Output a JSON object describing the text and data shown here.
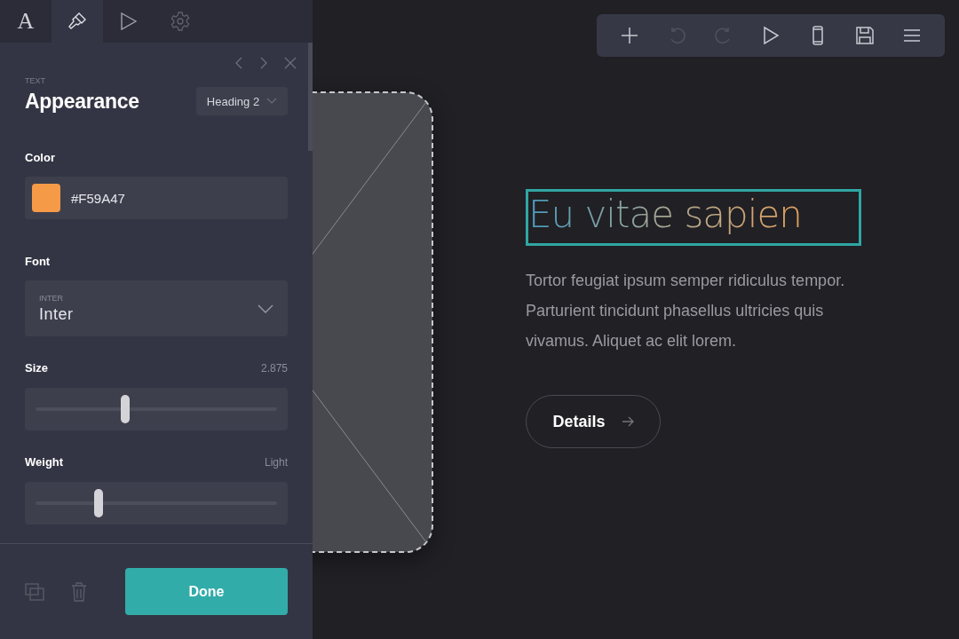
{
  "panel": {
    "tabs": [
      {
        "kind": "text",
        "glyph": "A",
        "selected": false
      },
      {
        "kind": "style",
        "selected": true
      },
      {
        "kind": "play",
        "selected": false
      },
      {
        "kind": "settings",
        "selected": false
      }
    ],
    "eyebrow": "TEXT",
    "title": "Appearance",
    "style_select": "Heading 2",
    "color": {
      "label": "Color",
      "value": "#F59A47"
    },
    "font": {
      "label": "Font",
      "caption": "INTER",
      "value": "Inter"
    },
    "size": {
      "label": "Size",
      "reading": "2.875",
      "level": 0.37
    },
    "weight": {
      "label": "Weight",
      "reading": "Light",
      "level": 0.26
    },
    "done": "Done"
  },
  "toolbar": [
    {
      "kind": "add",
      "disabled": false
    },
    {
      "kind": "undo",
      "disabled": true
    },
    {
      "kind": "redo",
      "disabled": true
    },
    {
      "kind": "preview",
      "disabled": false
    },
    {
      "kind": "mobile",
      "disabled": false
    },
    {
      "kind": "save",
      "disabled": false
    },
    {
      "kind": "menu",
      "disabled": false
    }
  ],
  "content": {
    "heading": "Eu vitae sapien",
    "body": "Tortor feugiat ipsum semper ridiculus tempor. Parturient tincidunt phasellus ultricies quis vivamus. Aliquet ac elit lorem.",
    "button": "Details"
  }
}
